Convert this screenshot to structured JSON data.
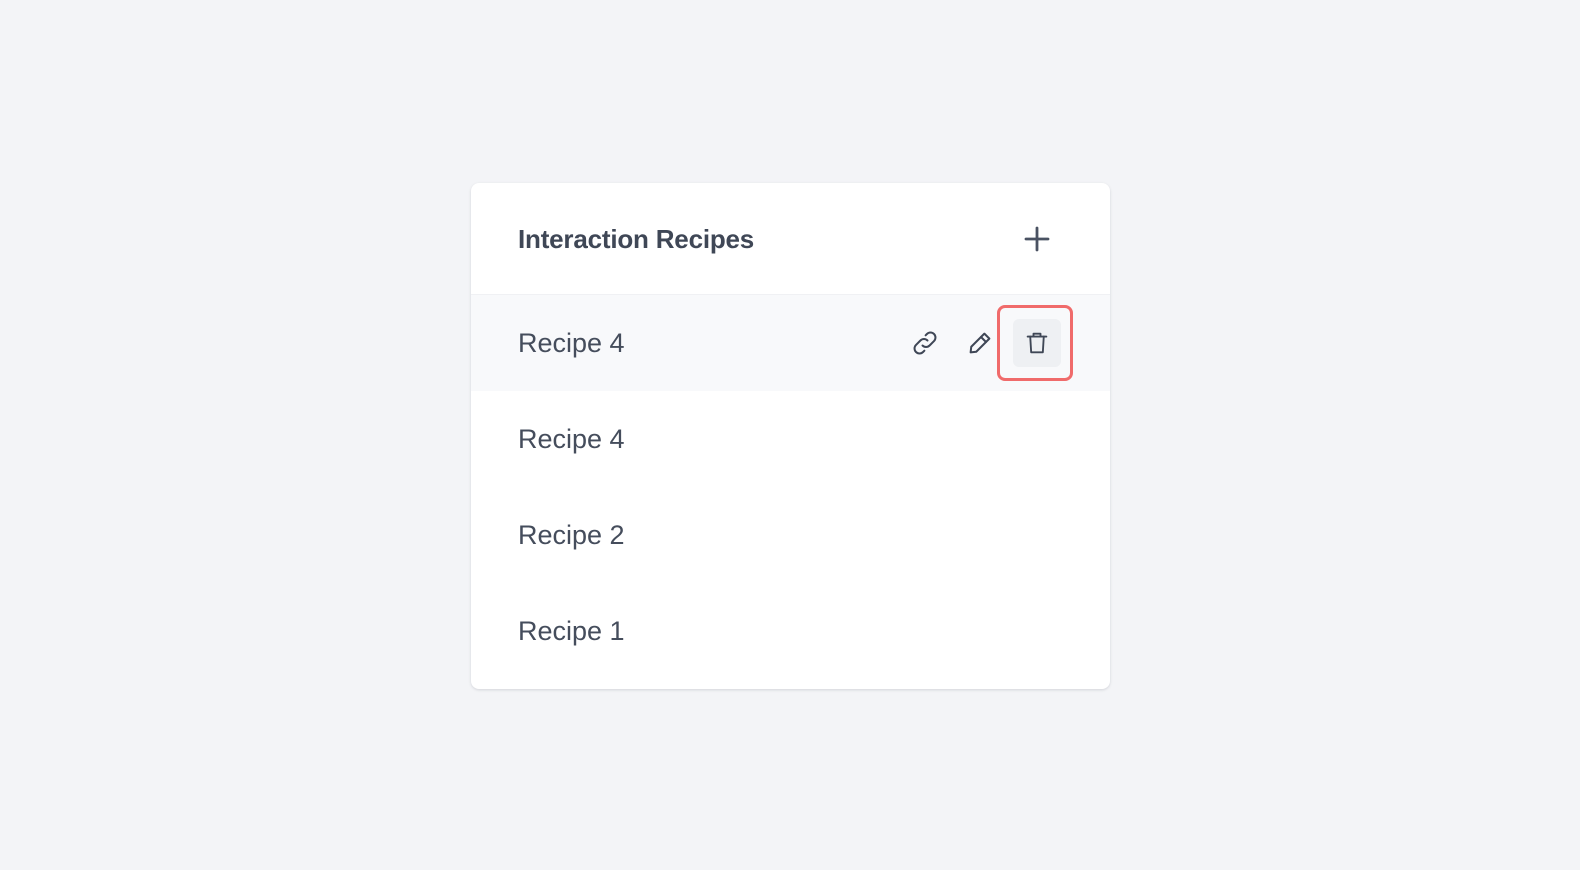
{
  "panel": {
    "title": "Interaction Recipes",
    "add_icon": "plus-icon"
  },
  "recipes": [
    {
      "label": "Recipe 4",
      "hovered": true,
      "actions": [
        {
          "name": "copy-link",
          "icon": "link-icon"
        },
        {
          "name": "edit",
          "icon": "pencil-icon"
        },
        {
          "name": "delete",
          "icon": "trash-icon",
          "highlighted": true
        }
      ]
    },
    {
      "label": "Recipe 4"
    },
    {
      "label": "Recipe 2"
    },
    {
      "label": "Recipe 1"
    }
  ],
  "colors": {
    "page_background": "#f3f4f7",
    "card_background": "#ffffff",
    "hover_row_background": "#f8f9fb",
    "text": "#454d5c",
    "icon": "#3f4756",
    "highlight": "#f06b6b"
  }
}
